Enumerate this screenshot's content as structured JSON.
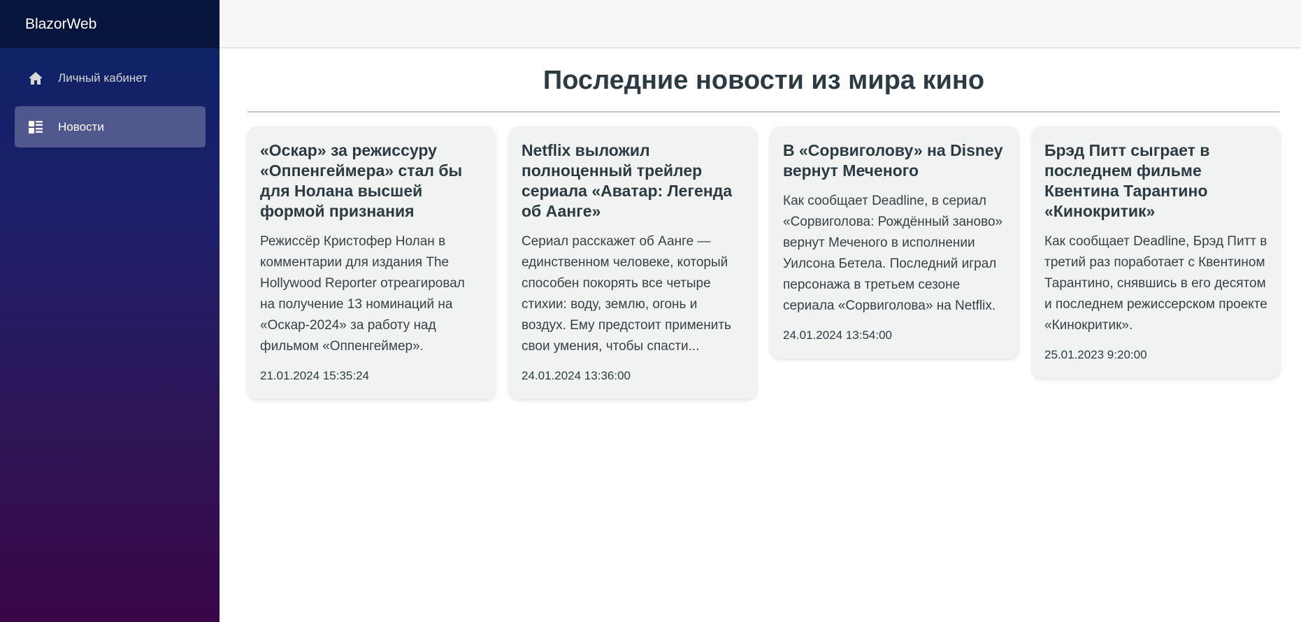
{
  "sidebar": {
    "brand": "BlazorWeb",
    "items": [
      {
        "label": "Личный кабинет",
        "icon": "home-icon",
        "active": false
      },
      {
        "label": "Новости",
        "icon": "list-view-icon",
        "active": true
      }
    ]
  },
  "main": {
    "title": "Последние новости из мира кино",
    "news": [
      {
        "title": "«Оскар» за режиссуру «Оппенгеймера» стал бы для Нолана высшей формой признания",
        "description": "Режиссёр Кристофер Нолан в комментарии для издания The Hollywood Reporter отреагировал на получение 13 номинаций на «Оскар-2024» за работу над фильмом «Оппенгеймер».",
        "date": "21.01.2024 15:35:24"
      },
      {
        "title": "Netflix выложил полноценный трейлер сериала «Аватар: Легенда об Аанге»",
        "description": "Сериал расскажет об Аанге — единственном человеке, который способен покорять все четыре стихии: воду, землю, огонь и воздух. Ему предстоит применить свои умения, чтобы спасти...",
        "date": "24.01.2024 13:36:00"
      },
      {
        "title": "В «Сорвиголову» на Disney вернут Меченого",
        "description": "Как сообщает Deadline, в сериал «Сорвиголова: Рождённый заново» вернут Меченого в исполнении Уилсона Бетела. Последний играл персонажа в третьем сезоне сериала «Сорвиголова» на Netflix.",
        "date": "24.01.2024 13:54:00"
      },
      {
        "title": "Брэд Питт сыграет в последнем фильме Квентина Тарантино «Кинокритик»",
        "description": "Как сообщает Deadline, Брэд Питт в третий раз поработает с Квентином Тарантино, снявшись в его десятом и последнем режиссерском проекте «Кинокритик».",
        "date": "25.01.2023 9:20:00"
      }
    ]
  }
}
